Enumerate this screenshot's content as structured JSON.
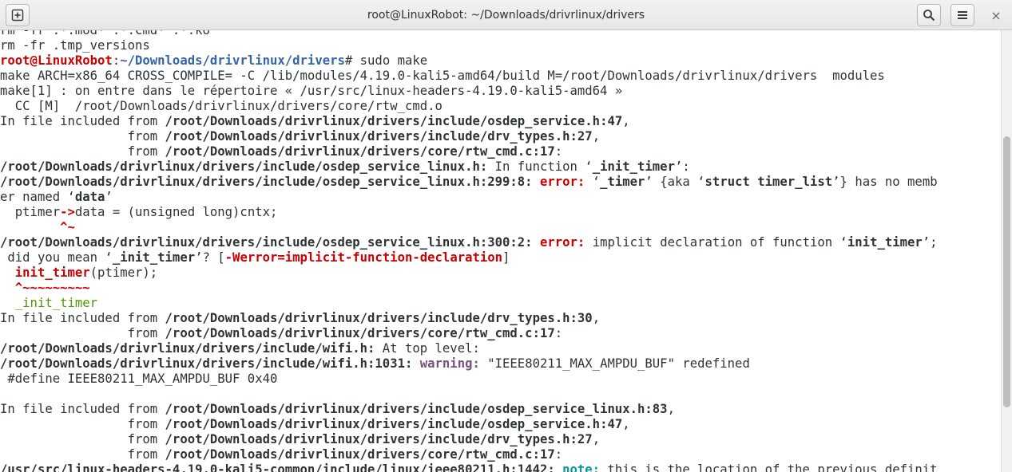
{
  "window": {
    "title": "root@LinuxRobot: ~/Downloads/drivrlinux/drivers",
    "close_glyph": "×"
  },
  "icons": {
    "new_tab": "new-tab-icon",
    "search": "search-icon",
    "menu": "hamburger-menu-icon",
    "close": "close-icon"
  },
  "colors": {
    "prompt_user": "#cc0000",
    "prompt_path": "#3465a4",
    "error": "#cc0000",
    "warning": "#75507b",
    "note": "#06989a",
    "fixit": "#4e9a06"
  },
  "terminal": {
    "lines": [
      [
        {
          "t": "rm -fr .*.mod* .*.cmd* .*.ko",
          "c": "p"
        }
      ],
      [
        {
          "t": "rm -fr .tmp_versions",
          "c": "p"
        }
      ],
      [
        {
          "t": "root@LinuxRobot",
          "c": "user"
        },
        {
          "t": ":",
          "c": "p"
        },
        {
          "t": "~/Downloads/drivrlinux/drivers",
          "c": "path"
        },
        {
          "t": "# sudo make",
          "c": "p"
        }
      ],
      [
        {
          "t": "make ARCH=x86_64 CROSS_COMPILE= -C /lib/modules/4.19.0-kali5-amd64/build M=/root/Downloads/drivrlinux/drivers  modules",
          "c": "p"
        }
      ],
      [
        {
          "t": "make[1] : on entre dans le répertoire « /usr/src/linux-headers-4.19.0-kali5-amd64 »",
          "c": "p"
        }
      ],
      [
        {
          "t": "  CC [M]  /root/Downloads/drivrlinux/drivers/core/rtw_cmd.o",
          "c": "p"
        }
      ],
      [
        {
          "t": "In file included from ",
          "c": "p"
        },
        {
          "t": "/root/Downloads/drivrlinux/drivers/include/osdep_service.h:47",
          "c": "b"
        },
        {
          "t": ",",
          "c": "p"
        }
      ],
      [
        {
          "t": "                 from ",
          "c": "p"
        },
        {
          "t": "/root/Downloads/drivrlinux/drivers/include/drv_types.h:27",
          "c": "b"
        },
        {
          "t": ",",
          "c": "p"
        }
      ],
      [
        {
          "t": "                 from ",
          "c": "p"
        },
        {
          "t": "/root/Downloads/drivrlinux/drivers/core/rtw_cmd.c:17",
          "c": "b"
        },
        {
          "t": ":",
          "c": "p"
        }
      ],
      [
        {
          "t": "/root/Downloads/drivrlinux/drivers/include/osdep_service_linux.h:",
          "c": "b"
        },
        {
          "t": " In function ‘",
          "c": "p"
        },
        {
          "t": "_init_timer",
          "c": "b"
        },
        {
          "t": "’:",
          "c": "p"
        }
      ],
      [
        {
          "t": "/root/Downloads/drivrlinux/drivers/include/osdep_service_linux.h:299:8:",
          "c": "b"
        },
        {
          "t": " ",
          "c": "p"
        },
        {
          "t": "error:",
          "c": "err"
        },
        {
          "t": " ‘",
          "c": "p"
        },
        {
          "t": "_timer",
          "c": "b"
        },
        {
          "t": "’ {aka ‘",
          "c": "p"
        },
        {
          "t": "struct timer_list",
          "c": "b"
        },
        {
          "t": "’} has no memb",
          "c": "p"
        }
      ],
      [
        {
          "t": "er named ‘",
          "c": "p"
        },
        {
          "t": "data",
          "c": "b"
        },
        {
          "t": "’",
          "c": "p"
        }
      ],
      [
        {
          "t": "  ptimer",
          "c": "p"
        },
        {
          "t": "->",
          "c": "err"
        },
        {
          "t": "data = (unsigned long)cntx;",
          "c": "p"
        }
      ],
      [
        {
          "t": "        ",
          "c": "p"
        },
        {
          "t": "^~",
          "c": "err"
        }
      ],
      [
        {
          "t": "/root/Downloads/drivrlinux/drivers/include/osdep_service_linux.h:300:2:",
          "c": "b"
        },
        {
          "t": " ",
          "c": "p"
        },
        {
          "t": "error:",
          "c": "err"
        },
        {
          "t": " implicit declaration of function ‘",
          "c": "p"
        },
        {
          "t": "init_timer",
          "c": "b"
        },
        {
          "t": "’;",
          "c": "p"
        }
      ],
      [
        {
          "t": " did you mean ‘",
          "c": "p"
        },
        {
          "t": "_init_timer",
          "c": "b"
        },
        {
          "t": "’? [",
          "c": "p"
        },
        {
          "t": "-Werror=implicit-function-declaration",
          "c": "err"
        },
        {
          "t": "]",
          "c": "p"
        }
      ],
      [
        {
          "t": "  ",
          "c": "p"
        },
        {
          "t": "init_timer",
          "c": "err"
        },
        {
          "t": "(ptimer);",
          "c": "p"
        }
      ],
      [
        {
          "t": "  ",
          "c": "p"
        },
        {
          "t": "^~~~~~~~~~",
          "c": "err"
        }
      ],
      [
        {
          "t": "  _init_timer",
          "c": "green"
        }
      ],
      [
        {
          "t": "In file included from ",
          "c": "p"
        },
        {
          "t": "/root/Downloads/drivrlinux/drivers/include/drv_types.h:30",
          "c": "b"
        },
        {
          "t": ",",
          "c": "p"
        }
      ],
      [
        {
          "t": "                 from ",
          "c": "p"
        },
        {
          "t": "/root/Downloads/drivrlinux/drivers/core/rtw_cmd.c:17",
          "c": "b"
        },
        {
          "t": ":",
          "c": "p"
        }
      ],
      [
        {
          "t": "/root/Downloads/drivrlinux/drivers/include/wifi.h:",
          "c": "b"
        },
        {
          "t": " At top level:",
          "c": "p"
        }
      ],
      [
        {
          "t": "/root/Downloads/drivrlinux/drivers/include/wifi.h:1031:",
          "c": "b"
        },
        {
          "t": " ",
          "c": "p"
        },
        {
          "t": "warning:",
          "c": "warn"
        },
        {
          "t": " \"IEEE80211_MAX_AMPDU_BUF\" redefined",
          "c": "p"
        }
      ],
      [
        {
          "t": " #define IEEE80211_MAX_AMPDU_BUF 0x40",
          "c": "p"
        }
      ],
      [
        {
          "t": "",
          "c": "p"
        }
      ],
      [
        {
          "t": "In file included from ",
          "c": "p"
        },
        {
          "t": "/root/Downloads/drivrlinux/drivers/include/osdep_service_linux.h:83",
          "c": "b"
        },
        {
          "t": ",",
          "c": "p"
        }
      ],
      [
        {
          "t": "                 from ",
          "c": "p"
        },
        {
          "t": "/root/Downloads/drivrlinux/drivers/include/osdep_service.h:47",
          "c": "b"
        },
        {
          "t": ",",
          "c": "p"
        }
      ],
      [
        {
          "t": "                 from ",
          "c": "p"
        },
        {
          "t": "/root/Downloads/drivrlinux/drivers/include/drv_types.h:27",
          "c": "b"
        },
        {
          "t": ",",
          "c": "p"
        }
      ],
      [
        {
          "t": "                 from ",
          "c": "p"
        },
        {
          "t": "/root/Downloads/drivrlinux/drivers/core/rtw_cmd.c:17",
          "c": "b"
        },
        {
          "t": ":",
          "c": "p"
        }
      ],
      [
        {
          "t": "/usr/src/linux-headers-4.19.0-kali5-common/include/linux/ieee80211.h:1442:",
          "c": "b"
        },
        {
          "t": " ",
          "c": "p"
        },
        {
          "t": "note:",
          "c": "note"
        },
        {
          "t": " this is the location of the previous definit",
          "c": "p"
        }
      ]
    ]
  }
}
